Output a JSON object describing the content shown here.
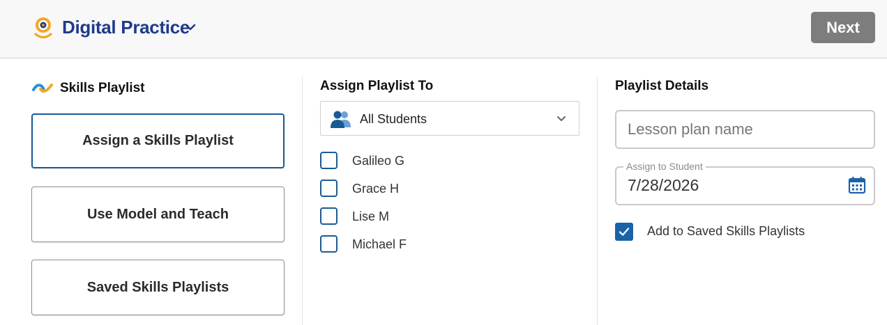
{
  "header": {
    "app_title": "Digital Practice",
    "logo_icon": "digital-practice-logo-icon",
    "chevron_icon": "chevron-down-icon",
    "next_label": "Next"
  },
  "left_panel": {
    "title": "Skills Playlist",
    "logo_icon": "skills-playlist-logo-icon",
    "options": [
      {
        "label": "Assign a Skills Playlist",
        "selected": true
      },
      {
        "label": "Use Model and Teach",
        "selected": false
      },
      {
        "label": "Saved Skills Playlists",
        "selected": false
      }
    ]
  },
  "middle_panel": {
    "title": "Assign Playlist To",
    "select": {
      "value": "All Students",
      "icon": "people-icon",
      "caret_icon": "chevron-down-icon"
    },
    "students": [
      {
        "name": "Galileo G",
        "checked": false
      },
      {
        "name": "Grace H",
        "checked": false
      },
      {
        "name": "Lise M",
        "checked": false
      },
      {
        "name": "Michael F",
        "checked": false
      }
    ]
  },
  "right_panel": {
    "title": "Playlist Details",
    "lesson_plan": {
      "placeholder": "Lesson plan name",
      "value": ""
    },
    "assign_date": {
      "label": "Assign to Student",
      "value": "7/28/2026",
      "icon": "calendar-icon"
    },
    "save_option": {
      "label": "Add to Saved Skills Playlists",
      "checked": true
    }
  },
  "colors": {
    "brand_blue": "#1f3a8a",
    "accent_blue": "#1a5a96",
    "checkbox_fill": "#1a63a8",
    "next_button": "#7d7d7d",
    "logo_orange": "#f5a623",
    "header_bg": "#f8f8f8"
  }
}
